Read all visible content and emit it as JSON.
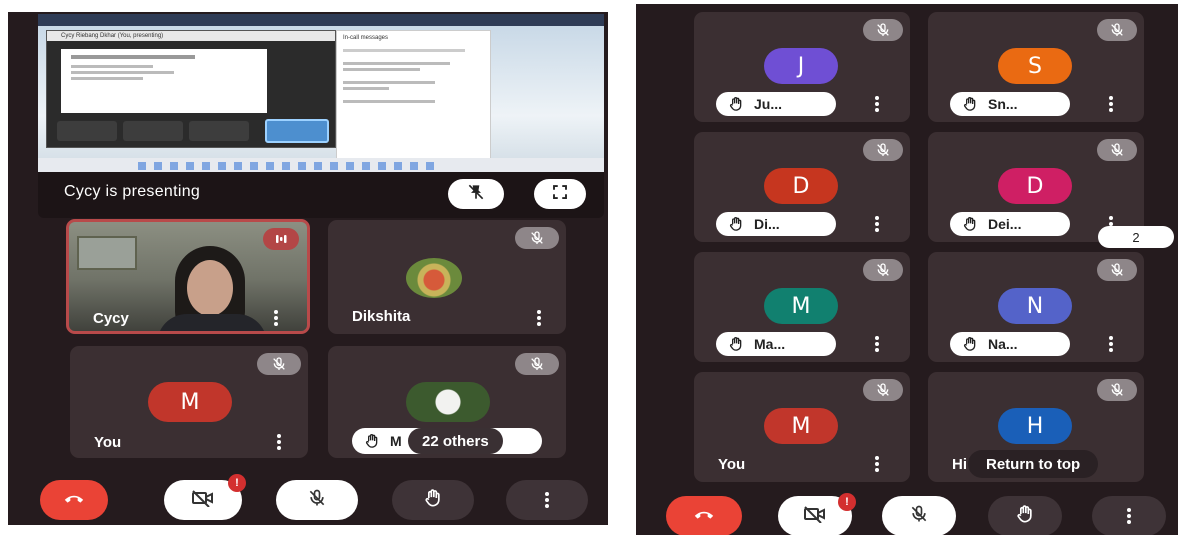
{
  "left": {
    "presenting_text": "Cycy is presenting",
    "shared_window_title": "Cycy Riebang Dkhar (You, presenting)",
    "shared_chat_title": "In-call messages",
    "tiles": [
      {
        "name": "Cycy",
        "type": "video"
      },
      {
        "name": "Dikshita",
        "type": "photo"
      },
      {
        "name": "You",
        "initial": "M",
        "color": "#c1362b"
      },
      {
        "name": "22 others",
        "type": "photo"
      }
    ],
    "others_pill_prefix": "M"
  },
  "right": {
    "tiles": [
      {
        "label": "Ju...",
        "initial": "J",
        "color": "#6f4fd4"
      },
      {
        "label": "Sn...",
        "initial": "S",
        "color": "#ea6a12"
      },
      {
        "label": "Di...",
        "initial": "D",
        "color": "#c6361f"
      },
      {
        "label": "Dei...",
        "initial": "D",
        "color": "#cf1f64"
      },
      {
        "label": "Ma...",
        "initial": "M",
        "color": "#11806f"
      },
      {
        "label": "Na...",
        "initial": "N",
        "color": "#5463c9"
      },
      {
        "label": "You",
        "initial": "M",
        "color": "#c1362b"
      },
      {
        "label": "Hi",
        "initial": "H",
        "color": "#1a5fb8"
      }
    ],
    "badge_count": "2",
    "return_to_top": "Return to top"
  },
  "controls": {
    "video_notification": "!"
  },
  "colors": {
    "background": "#251b1e",
    "tile": "#3b2f32",
    "end_call": "#ea4336",
    "active_speaker_border": "#b84a4a"
  },
  "icons": [
    "hand-raise-icon",
    "mic-off-icon",
    "more-vert-icon",
    "end-call-icon",
    "video-off-icon",
    "fullscreen-icon",
    "present-stop-icon"
  ]
}
